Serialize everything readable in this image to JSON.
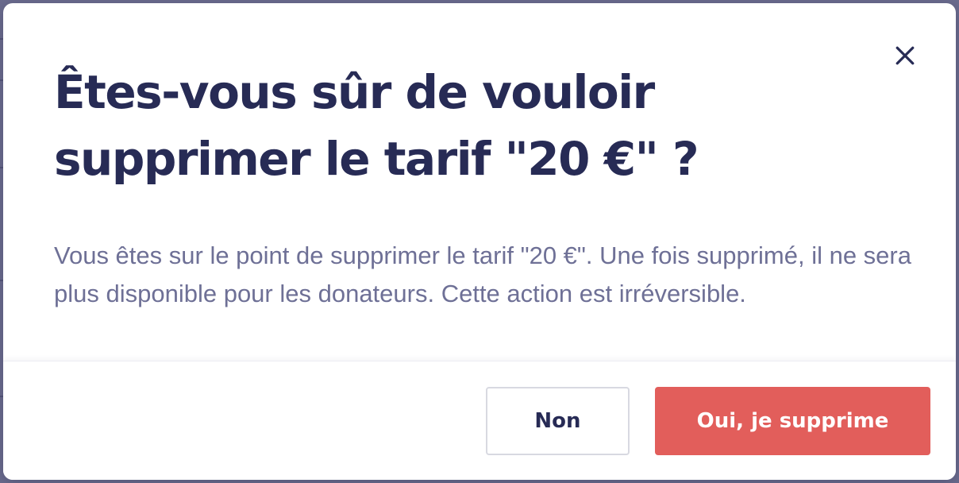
{
  "dialog": {
    "title": "Êtes-vous sûr de vouloir supprimer le tarif \"20 €\" ?",
    "message": "Vous êtes sur le point de supprimer le tarif \"20 €\". Une fois supprimé, il ne sera plus disponible pour les donateurs. Cette action est irréversible.",
    "close_icon": "close-icon",
    "cancel_label": "Non",
    "confirm_label": "Oui, je supprime"
  },
  "colors": {
    "title": "#272b55",
    "message": "#6e7096",
    "danger": "#e25e5b",
    "overlay": "#6b6c8e"
  }
}
